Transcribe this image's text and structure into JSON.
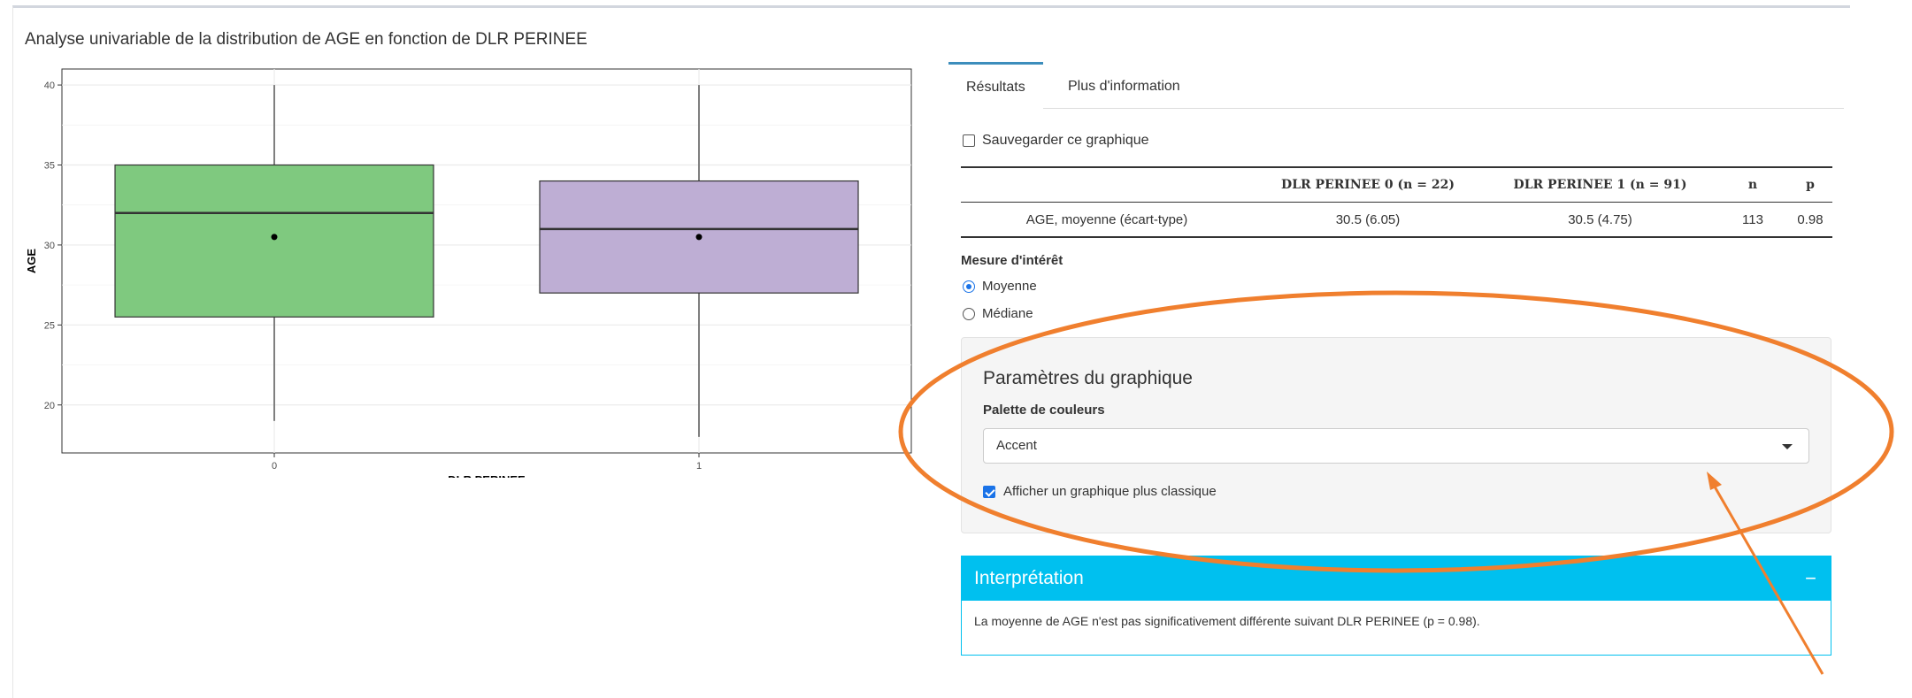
{
  "panel_title": "Analyse univariable de la distribution de AGE en fonction de DLR PERINEE",
  "tabs": [
    {
      "label": "Résultats",
      "active": true
    },
    {
      "label": "Plus d'information",
      "active": false
    }
  ],
  "save_graph": {
    "label": "Sauvegarder ce graphique",
    "checked": false
  },
  "table": {
    "headers": [
      "",
      "DLR PERINEE 0 (n = 22)",
      "DLR PERINEE 1 (n = 91)",
      "n",
      "p"
    ],
    "rows": [
      [
        "AGE, moyenne (écart-type)",
        "30.5 (6.05)",
        "30.5 (4.75)",
        "113",
        "0.98"
      ]
    ]
  },
  "mesure": {
    "title": "Mesure d'intérêt",
    "options": [
      {
        "label": "Moyenne",
        "selected": true
      },
      {
        "label": "Médiane",
        "selected": false
      }
    ]
  },
  "graph_params": {
    "title": "Paramètres du graphique",
    "palette_label": "Palette de couleurs",
    "palette_value": "Accent",
    "classic_label": "Afficher un graphique plus classique",
    "classic_checked": true
  },
  "interpretation": {
    "title": "Interprétation",
    "collapse_symbol": "−",
    "text": "La moyenne de AGE n'est pas significativement différente suivant DLR PERINEE (p = 0.98)."
  },
  "colors": {
    "accent_blue": "#3c8dbc",
    "info_box": "#00c0ef",
    "annotation": "#f07f2e",
    "box_green": "#7fc97f",
    "box_purple": "#beaed4"
  },
  "chart_data": {
    "type": "boxplot",
    "xlabel": "DLR PERINEE",
    "ylabel": "AGE",
    "ylim": [
      17,
      41
    ],
    "yticks": [
      20,
      25,
      30,
      35,
      40
    ],
    "categories": [
      "0",
      "1"
    ],
    "boxes": [
      {
        "category": "0",
        "whisker_low": 19,
        "q1": 25.5,
        "median": 32,
        "q3": 35,
        "whisker_high": 40,
        "mean": 30.5,
        "color": "#7fc97f"
      },
      {
        "category": "1",
        "whisker_low": 18,
        "q1": 27,
        "median": 31,
        "q3": 34,
        "whisker_high": 40,
        "mean": 30.5,
        "color": "#beaed4"
      }
    ],
    "grid": true
  }
}
